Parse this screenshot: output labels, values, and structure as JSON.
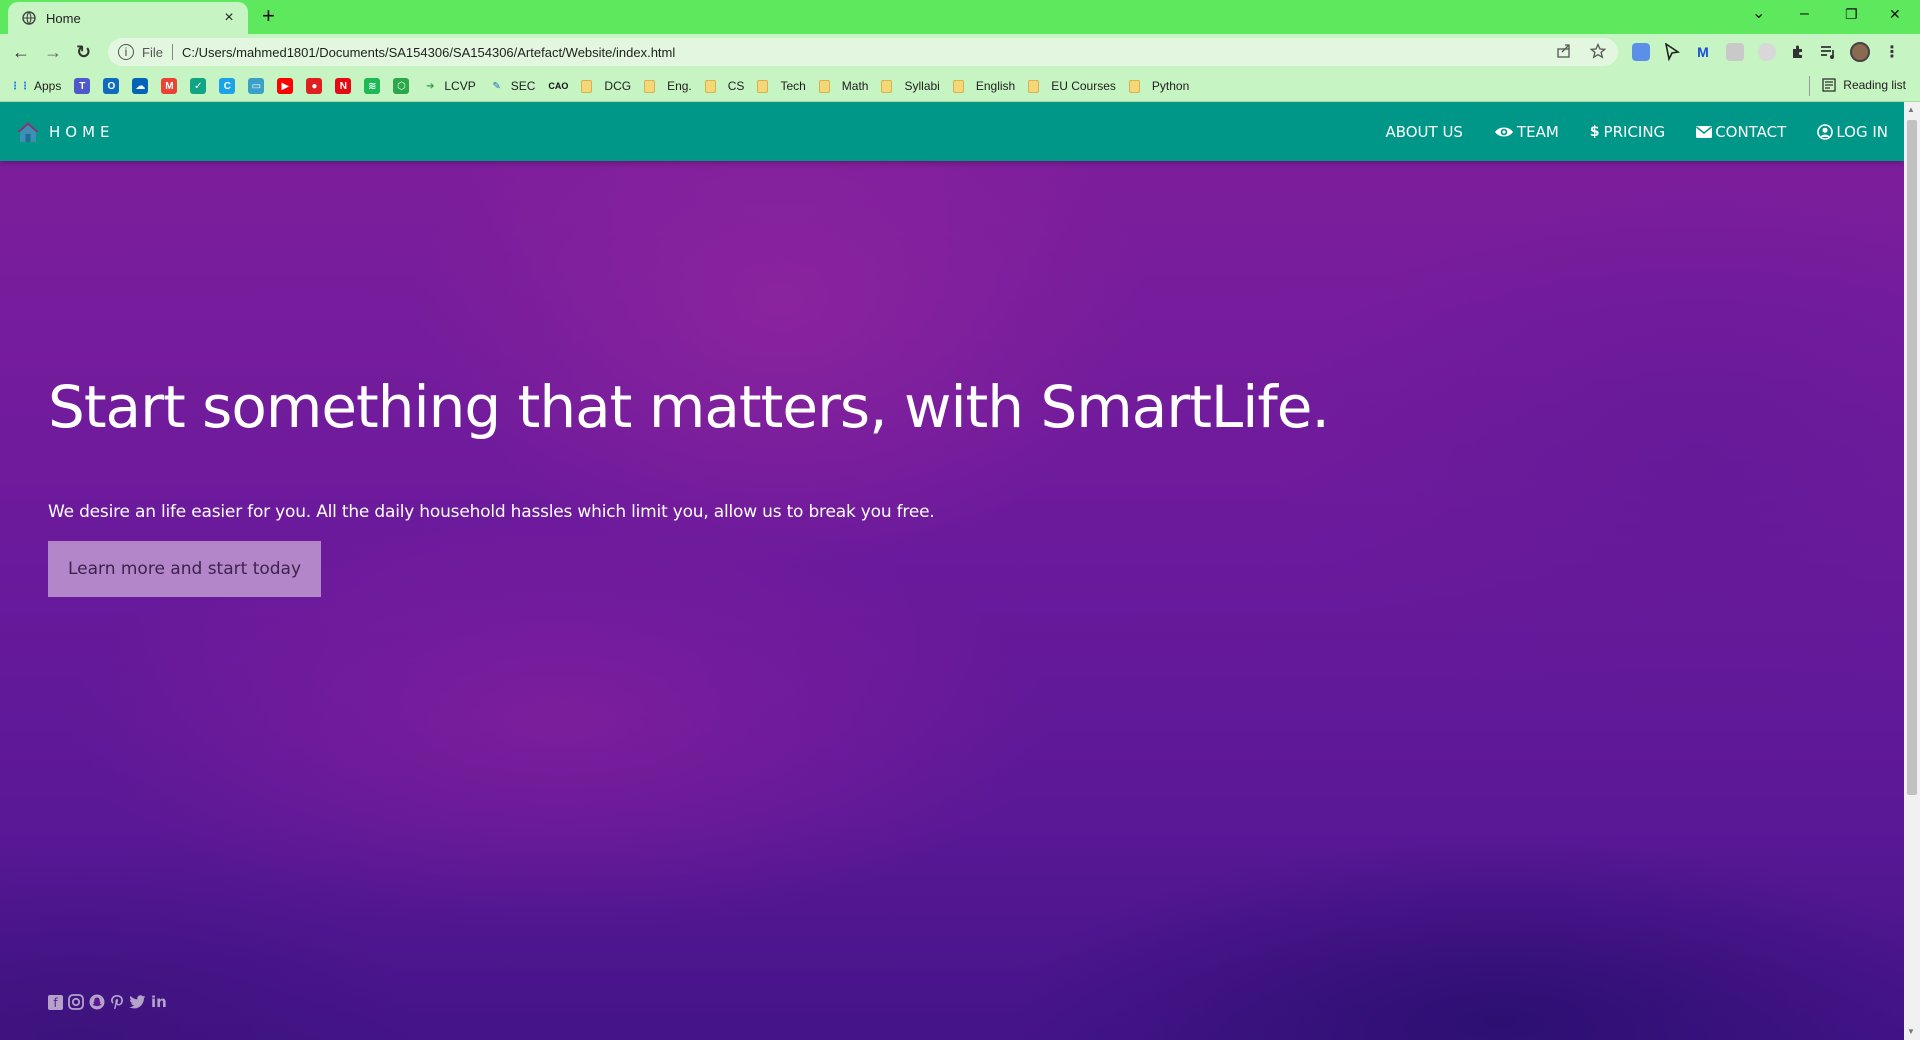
{
  "browser": {
    "tab_title": "Home",
    "tab_close": "×",
    "new_tab": "+",
    "window_controls": {
      "dropdown": "⌄",
      "minimize": "–",
      "restore": "❐",
      "close": "✕"
    },
    "nav": {
      "back": "←",
      "forward": "→",
      "reload": "↻"
    },
    "address": {
      "scheme_label": "File",
      "url": "C:/Users/mahmed1801/Documents/SA154306/SA154306/Artefact/Website/index.html"
    },
    "bookmarks": [
      {
        "label": "Apps",
        "icon": "apps-grid-icon",
        "color": "#1a73e8"
      },
      {
        "label": "",
        "icon": "teams-icon",
        "color": "#5059c9"
      },
      {
        "label": "",
        "icon": "outlook-icon",
        "color": "#0f6cbd"
      },
      {
        "label": "",
        "icon": "onedrive-icon",
        "color": "#0364b8"
      },
      {
        "label": "",
        "icon": "gmail-icon",
        "color": "#ea4335"
      },
      {
        "label": "",
        "icon": "shield-check-icon",
        "color": "#11a683"
      },
      {
        "label": "",
        "icon": "c-circle-icon",
        "color": "#1aa3e8"
      },
      {
        "label": "",
        "icon": "monitor-icon",
        "color": "#3aa0c8"
      },
      {
        "label": "",
        "icon": "youtube-icon",
        "color": "#ff0000"
      },
      {
        "label": "",
        "icon": "record-icon",
        "color": "#e02020"
      },
      {
        "label": "",
        "icon": "netflix-icon",
        "color": "#e50914"
      },
      {
        "label": "",
        "icon": "spotify-icon",
        "color": "#1db954"
      },
      {
        "label": "",
        "icon": "hexagon-icon",
        "color": "#2aa84a"
      },
      {
        "label": "LCVP",
        "icon": "arrow-leaf-icon",
        "color": "#2e9e4f"
      },
      {
        "label": "SEC",
        "icon": "pen-icon",
        "color": "#2366c4"
      },
      {
        "label": "",
        "icon": "cao-icon",
        "color": "#111111"
      },
      {
        "label": "DCG",
        "icon": "folder-icon",
        "color": "#f5d77a"
      },
      {
        "label": "Eng.",
        "icon": "folder-icon",
        "color": "#f5d77a"
      },
      {
        "label": "CS",
        "icon": "folder-icon",
        "color": "#f5d77a"
      },
      {
        "label": "Tech",
        "icon": "folder-icon",
        "color": "#f5d77a"
      },
      {
        "label": "Math",
        "icon": "folder-icon",
        "color": "#f5d77a"
      },
      {
        "label": "Syllabi",
        "icon": "folder-icon",
        "color": "#f5d77a"
      },
      {
        "label": "English",
        "icon": "folder-icon",
        "color": "#f5d77a"
      },
      {
        "label": "EU Courses",
        "icon": "folder-icon",
        "color": "#f5d77a"
      },
      {
        "label": "Python",
        "icon": "folder-icon",
        "color": "#f5d77a"
      }
    ],
    "cao_text": "CAO",
    "reading_list": "Reading list"
  },
  "site": {
    "brand": "HOME",
    "nav_color": "#009688",
    "nav": [
      {
        "label": "ABOUT US",
        "icon": ""
      },
      {
        "label": "TEAM",
        "icon": "eye-icon"
      },
      {
        "label": "PRICING",
        "icon": "dollar-icon"
      },
      {
        "label": "CONTACT",
        "icon": "envelope-icon"
      },
      {
        "label": "LOG IN",
        "icon": "user-circle-icon"
      }
    ],
    "hero": {
      "title": "Start something that matters, with SmartLife.",
      "subtitle": "We desire an life easier for you. All the daily household hassles which limit you, allow us to break you free.",
      "cta": "Learn more and start today"
    },
    "socials": [
      "facebook-icon",
      "instagram-icon",
      "snapchat-icon",
      "pinterest-icon",
      "twitter-icon",
      "linkedin-icon"
    ],
    "social_glyphs": {
      "linkedin": "in"
    }
  }
}
